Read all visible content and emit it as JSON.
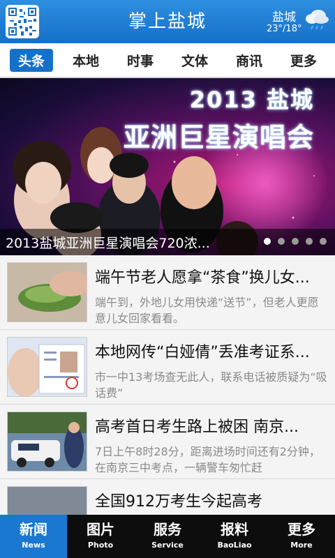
{
  "header": {
    "title": "掌上盐城",
    "weather": {
      "city": "盐城",
      "temp": "23°/18°",
      "icon": "cloud-rain-icon"
    }
  },
  "tabs": [
    {
      "label": "头条",
      "active": true
    },
    {
      "label": "本地"
    },
    {
      "label": "时事"
    },
    {
      "label": "文体"
    },
    {
      "label": "商讯"
    },
    {
      "label": "更多"
    }
  ],
  "banner": {
    "headline_year": "2013 盐城",
    "headline_name": "亚洲巨星演唱会",
    "caption": "2013盐城亚洲巨星演唱会720浓...",
    "slides": 5,
    "active_slide": 1
  },
  "news": [
    {
      "title": "端午节老人愿拿“茶食”换儿女...",
      "summary": "端午到，外地儿女用快递“送节”，但老人更愿意儿女回家看看。"
    },
    {
      "title": "本地网传“白娅倩”丢准考证系...",
      "summary": "市一中13考场查无此人，联系电话被质疑为“吸话费”"
    },
    {
      "title": "高考首日考生路上被困 南京...",
      "summary": "7日上午8时28分，距离进场时间还有2分钟，在南京三中考点，一辆警车匆忙赶"
    },
    {
      "title": "全国912万考生今起高考",
      "summary": ""
    }
  ],
  "bottom_nav": [
    {
      "cn": "新闻",
      "en": "News",
      "active": true
    },
    {
      "cn": "图片",
      "en": "Photo"
    },
    {
      "cn": "服务",
      "en": "Service"
    },
    {
      "cn": "报料",
      "en": "BaoLiao"
    },
    {
      "cn": "更多",
      "en": "More"
    }
  ],
  "colors": {
    "primary": "#1570c8",
    "nav_bg": "#0d0d0d"
  }
}
